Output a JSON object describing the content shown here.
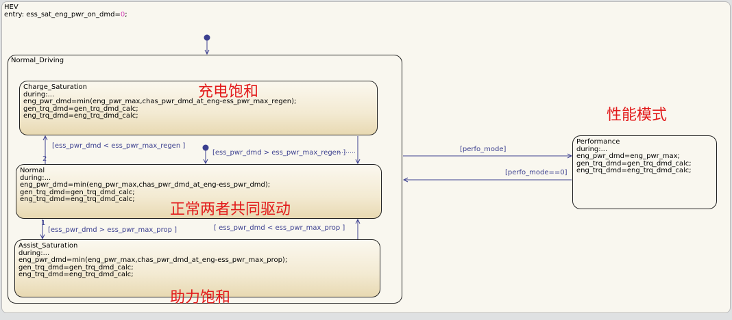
{
  "hev": {
    "title": "HEV",
    "entry_prefix": "entry: ess_sat_eng_pwr_on_dmd=",
    "entry_value": "0",
    "entry_suffix": ";"
  },
  "normal_driving": {
    "title": "Normal_Driving"
  },
  "charge_saturation": {
    "title": "Charge_Saturation",
    "lines": [
      "during:...",
      "eng_pwr_dmd=min(eng_pwr_max,chas_pwr_dmd_at_eng-ess_pwr_max_regen);",
      "gen_trq_dmd=gen_trq_dmd_calc;",
      "eng_trq_dmd=eng_trq_dmd_calc;"
    ],
    "note": "充电饱和"
  },
  "normal": {
    "title": "Normal",
    "lines": [
      "during:...",
      "eng_pwr_dmd=min(eng_pwr_max,chas_pwr_dmd_at_eng-ess_pwr_dmd);",
      "gen_trq_dmd=gen_trq_dmd_calc;",
      "eng_trq_dmd=eng_trq_dmd_calc;"
    ],
    "note": "正常两者共同驱动"
  },
  "assist_saturation": {
    "title": "Assist_Saturation",
    "lines": [
      "during:...",
      "eng_pwr_dmd=min(eng_pwr_max,chas_pwr_dmd_at_eng-ess_pwr_max_prop);",
      "gen_trq_dmd=gen_trq_dmd_calc;",
      "eng_trq_dmd=eng_trq_dmd_calc;"
    ],
    "note": "助力饱和"
  },
  "performance": {
    "title": "Performance",
    "lines": [
      "during:...",
      "eng_pwr_dmd=eng_pwr_max;",
      "gen_trq_dmd=gen_trq_dmd_calc;",
      "eng_trq_dmd=eng_trq_dmd_calc;"
    ],
    "note": "性能模式"
  },
  "transitions": {
    "to_charge": "[ess_pwr_dmd < ess_pwr_max_regen  ]",
    "to_charge_priority": "2",
    "from_charge": "[ess_pwr_dmd > ess_pwr_max_regen ]",
    "to_assist": "[ess_pwr_dmd > ess_pwr_max_prop ]",
    "to_assist_priority": "1",
    "from_assist": "[ ess_pwr_dmd < ess_pwr_max_prop ]",
    "to_performance": "[perfo_mode]",
    "from_performance": "[perfo_mode==0]"
  },
  "colors": {
    "state_border": "#222222",
    "transition": "#3b3f8f",
    "annotation": "#e21b1b",
    "background": "#f9f7ef"
  }
}
